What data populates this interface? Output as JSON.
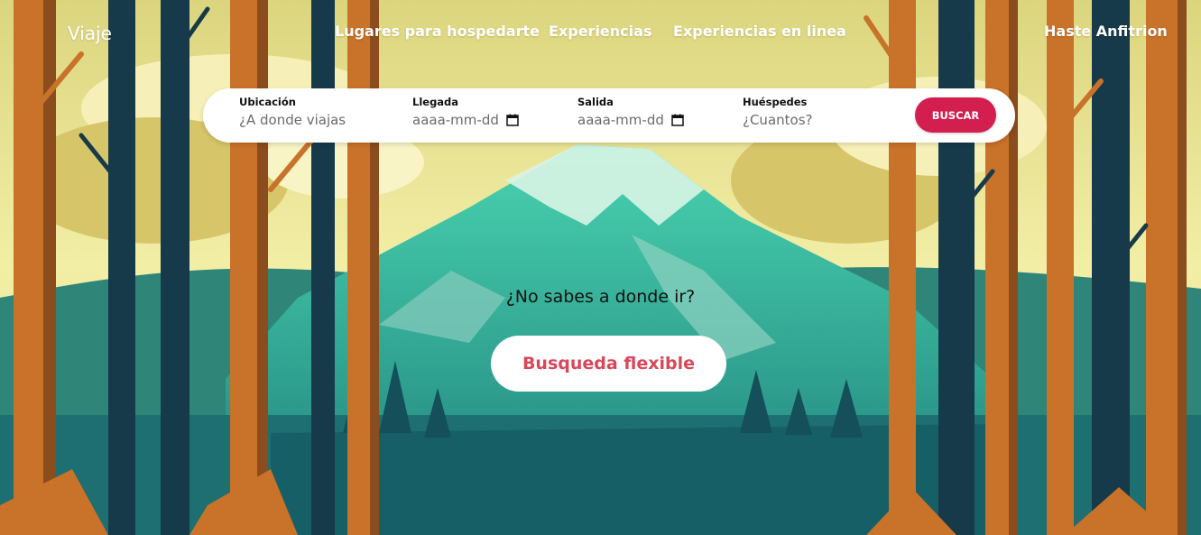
{
  "header": {
    "brand": "Viaje",
    "nav": [
      "Lugares para hospedarte",
      "Experiencias",
      "Experiencias en linea"
    ],
    "host_link": "Haste Anfitrion"
  },
  "search": {
    "location": {
      "label": "Ubicación",
      "placeholder": "¿A donde viajas"
    },
    "arrival": {
      "label": "Llegada",
      "placeholder": "aaaa-mm-dd"
    },
    "departure": {
      "label": "Salida",
      "placeholder": "aaaa-mm-dd"
    },
    "guests": {
      "label": "Huéspedes",
      "placeholder": "¿Cuantos?"
    },
    "button": "BUSCAR"
  },
  "hero": {
    "prompt": "¿No sabes a donde ir?",
    "button": "Busqueda flexible"
  },
  "colors": {
    "accent": "#d21f50",
    "flex_button_text": "#d9475a",
    "sky": "#e3de86",
    "mountain": "#2a9c8c",
    "tree_orange": "#c8722a",
    "tree_dark": "#163a4a"
  },
  "icons": [
    "calendar-icon"
  ]
}
